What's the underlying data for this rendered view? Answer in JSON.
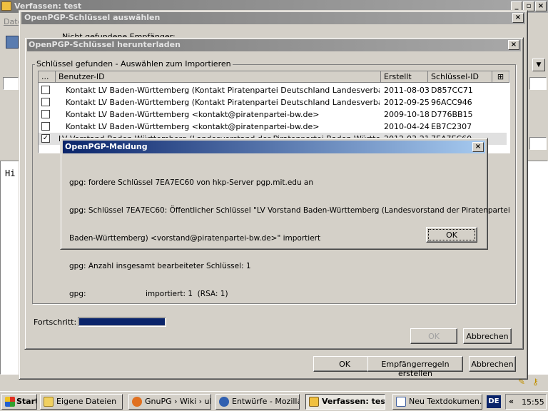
{
  "compose": {
    "title": "Verfassen: test",
    "menu_first": "Date",
    "body_text": "Hi",
    "window_controls": [
      "_",
      "×"
    ]
  },
  "select_dialog": {
    "title": "OpenPGP-Schlüssel auswählen",
    "hint": "Nicht gefundene Empfänger:",
    "ok_label": "OK",
    "rules_label": "Empfängerregeln erstellen",
    "cancel_label": "Abbrechen"
  },
  "download_dialog": {
    "title": "OpenPGP-Schlüssel herunterladen",
    "group_label": "Schlüssel gefunden - Auswählen zum Importieren",
    "columns": [
      "...",
      "Benutzer-ID",
      "Erstellt",
      "Schlüssel-ID"
    ],
    "rows": [
      {
        "checked": false,
        "user": "Kontakt LV Baden-Württemberg (Kontakt Piratenpartei Deutschland Landesverband Baden-W...",
        "created": "2011-08-03",
        "keyid": "D857CC71"
      },
      {
        "checked": false,
        "user": "Kontakt LV Baden-Württemberg (Kontakt Piratenpartei Deutschland Landesverband Baden-W...",
        "created": "2012-09-25",
        "keyid": "96ACC946"
      },
      {
        "checked": false,
        "user": "Kontakt LV Baden-Württemberg <kontakt@piratenpartei-bw.de>",
        "created": "2009-10-18",
        "keyid": "D776BB15"
      },
      {
        "checked": false,
        "user": "Kontakt LV Baden-Württemberg <kontakt@piratenpartei-bw.de>",
        "created": "2010-04-24",
        "keyid": "EB7C2307"
      },
      {
        "checked": true,
        "user": "LV Vorstand Baden-Württemberg (Landesvorstand der Piratenpartei Baden-Württemberg) <v...",
        "created": "2012-03-21",
        "keyid": "7EA7EC60"
      }
    ],
    "progress_label": "Fortschritt:",
    "progress_value": 1.0,
    "ok_label": "OK",
    "cancel_label": "Abbrechen"
  },
  "message_dialog": {
    "title": "OpenPGP-Meldung",
    "lines": [
      "gpg: fordere Schlüssel 7EA7EC60 von hkp-Server pgp.mit.edu an",
      "gpg: Schlüssel 7EA7EC60: Öffentlicher Schlüssel \"LV Vorstand Baden-Württemberg (Landesvorstand der Piratenpartei",
      "Baden-Württemberg) <vorstand@piratenpartei-bw.de>\" importiert",
      "gpg: Anzahl insgesamt bearbeiteter Schlüssel: 1",
      "gpg:                         importiert: 1  (RSA: 1)"
    ],
    "ok_label": "OK"
  },
  "taskbar": {
    "start_label": "Start",
    "tasks": [
      {
        "label": "Eigene Dateien",
        "active": false
      },
      {
        "label": "GnuPG › Wiki › ub...",
        "active": false
      },
      {
        "label": "Entwürfe - Mozilla...",
        "active": false
      },
      {
        "label": "Verfassen: test",
        "active": true
      },
      {
        "label": "Neu Textdokumen...",
        "active": false
      }
    ],
    "lang": "DE",
    "chevron": "«",
    "clock": "15:55"
  },
  "colors": {
    "title_active": "#0a246a",
    "title_inactive": "#7a7a7a",
    "progress_fill": "#0a246a",
    "start_green": "#3a8a2a"
  }
}
